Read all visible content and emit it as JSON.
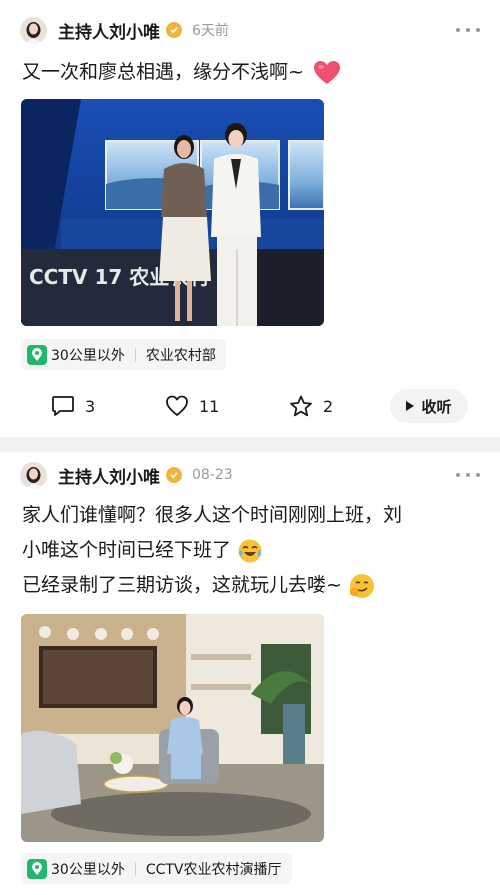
{
  "posts": [
    {
      "author": "主持人刘小唯",
      "time": "6天前",
      "text_lines": [
        "又一次和廖总相遇，缘分不浅啊~"
      ],
      "emojis": [
        "heart-emoji"
      ],
      "image_signage": "CCTV 17 农业农村",
      "location": {
        "distance": "30公里以外",
        "place": "农业农村部"
      },
      "actions": {
        "comments": "3",
        "likes": "11",
        "favorites": "2",
        "listen": "收听"
      }
    },
    {
      "author": "主持人刘小唯",
      "time": "08-23",
      "text_lines": [
        "家人们谁懂啊？很多人这个时间刚刚上班，刘",
        "小唯这个时间已经下班了",
        "已经录制了三期访谈，这就玩儿去喽~"
      ],
      "emojis": [
        "laughing-crying-emoji",
        "smirking-emoji"
      ],
      "location": {
        "distance": "30公里以外",
        "place": "CCTV农业农村演播厅"
      }
    }
  ],
  "colors": {
    "verify_badge": "#f0b43c",
    "location_pin": "#21b86b",
    "heart": "#f0506e",
    "muted_text": "#9a9a9a"
  }
}
